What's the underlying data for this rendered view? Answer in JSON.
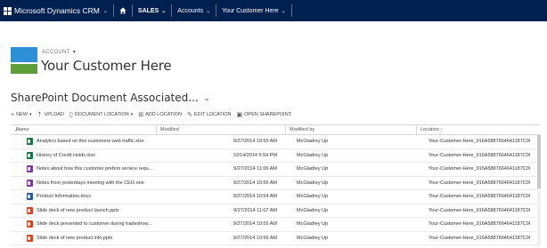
{
  "app": {
    "brand": "Microsoft Dynamics CRM",
    "bar_color": "#002050"
  },
  "nav": {
    "home_icon": "home-icon",
    "items": [
      {
        "label": "SALES"
      },
      {
        "label": "Accounts"
      },
      {
        "label": "Your Customer Here"
      }
    ]
  },
  "entity": {
    "type_label": "ACCOUNT",
    "name": "Your Customer Here"
  },
  "grid": {
    "title": "SharePoint Document Associated...",
    "commands": [
      {
        "label": "NEW",
        "icon": "plus-icon"
      },
      {
        "label": "UPLOAD",
        "icon": "upload-icon"
      },
      {
        "label": "DOCUMENT LOCATION",
        "icon": "document-icon"
      },
      {
        "label": "ADD LOCATION",
        "icon": "add-location-icon"
      },
      {
        "label": "EDIT LOCATION",
        "icon": "edit-icon"
      },
      {
        "label": "OPEN SHAREPOINT",
        "icon": "sharepoint-icon"
      }
    ],
    "columns": {
      "check": "✓",
      "name": "Name",
      "modified": "Modified",
      "modified_by": "Modified by",
      "location": "Location ↑"
    },
    "rows": [
      {
        "icon": "excel",
        "name": "Analytics based on this customers web traffic.xlsx",
        "modified": "9/27/2014 10:55 AM",
        "modified_by": "McGladrey Up",
        "location": "Your-Customer-Here_916A5887664641187C06C38..."
      },
      {
        "icon": "excel",
        "name": "History of Credit Holds.xlsx",
        "modified": "10/14/2014 6:54 PM",
        "modified_by": "McGladrey Up",
        "location": "Your-Customer-Here_916A5887664641187C06C38..."
      },
      {
        "icon": "onenote",
        "name": "Notes about how this customer prefers service requ...",
        "modified": "9/27/2014 11:06 AM",
        "modified_by": "McGladrey Up",
        "location": "Your-Customer-Here_916A5887664641187C06C38..."
      },
      {
        "icon": "onenote",
        "name": "Notes from yesterdays meeting with the CEO.one",
        "modified": "9/27/2014 10:56 AM",
        "modified_by": "McGladrey Up",
        "location": "Your-Customer-Here_916A5887664641187C06C38..."
      },
      {
        "icon": "word",
        "name": "Product Information.docx",
        "modified": "9/27/2014 10:54 AM",
        "modified_by": "McGladrey Up",
        "location": "Your-Customer-Here_916A5887664641187C06C38..."
      },
      {
        "icon": "powerpoint",
        "name": "Slide deck of new product launch.pptx",
        "modified": "9/27/2014 11:07 AM",
        "modified_by": "McGladrey Up",
        "location": "Your-Customer-Here_916A5887664641187C06C38..."
      },
      {
        "icon": "powerpoint",
        "name": "Slide deck presented to customer during tradeshow...",
        "modified": "9/27/2014 10:55 AM",
        "modified_by": "McGladrey Up",
        "location": "Your-Customer-Here_916A5887664641187C06C38..."
      },
      {
        "icon": "powerpoint",
        "name": "Slide deck of new product info.pptx",
        "modified": "9/27/2014 10:56 AM",
        "modified_by": "McGladrey Up",
        "location": "Your-Customer-Here_916A5887664641187C06C38..."
      }
    ]
  },
  "colors": {
    "excel": "#1e7145",
    "onenote": "#7a3d9c",
    "word": "#2b579a",
    "powerpoint": "#d24726",
    "entity_blue": "#2d8fd5",
    "entity_green": "#5f9e3a"
  }
}
